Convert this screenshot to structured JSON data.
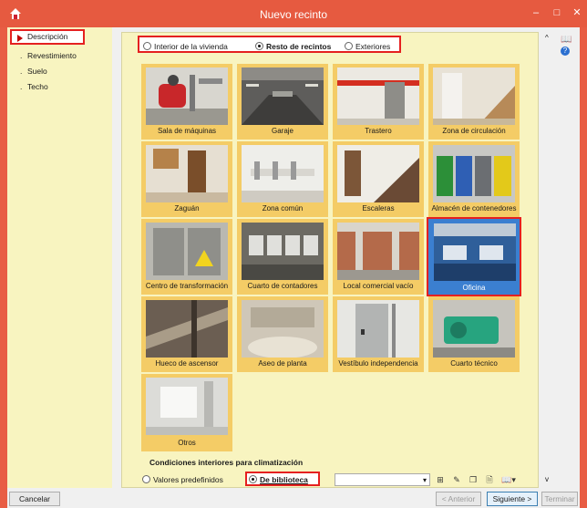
{
  "window": {
    "title": "Nuevo recinto",
    "minimize_glyph": "–",
    "maximize_glyph": "□",
    "close_glyph": "✕"
  },
  "sidebar": {
    "items": [
      {
        "label": "Descripción",
        "selected": true
      },
      {
        "label": "Revestimiento",
        "selected": false
      },
      {
        "label": "Suelo",
        "selected": false
      },
      {
        "label": "Techo",
        "selected": false
      }
    ],
    "bullet": "."
  },
  "scope": {
    "options": [
      {
        "label": "Interior de la vivienda",
        "selected": false
      },
      {
        "label": "Resto de recintos",
        "selected": true
      },
      {
        "label": "Exteriores",
        "selected": false
      }
    ]
  },
  "tiles": [
    {
      "label": "Sala de máquinas",
      "selected": false
    },
    {
      "label": "Garaje",
      "selected": false
    },
    {
      "label": "Trastero",
      "selected": false
    },
    {
      "label": "Zona de circulación",
      "selected": false
    },
    {
      "label": "Zaguán",
      "selected": false
    },
    {
      "label": "Zona común",
      "selected": false
    },
    {
      "label": "Escaleras",
      "selected": false
    },
    {
      "label": "Almacén de contenedores",
      "selected": false
    },
    {
      "label": "Centro de transformación",
      "selected": false
    },
    {
      "label": "Cuarto de contadores",
      "selected": false
    },
    {
      "label": "Local comercial vacío",
      "selected": false
    },
    {
      "label": "Oficina",
      "selected": true
    },
    {
      "label": "Hueco de ascensor",
      "selected": false
    },
    {
      "label": "Aseo de planta",
      "selected": false
    },
    {
      "label": "Vestíbulo independencia",
      "selected": false
    },
    {
      "label": "Cuarto técnico",
      "selected": false
    },
    {
      "label": "Otros",
      "selected": false
    }
  ],
  "climate": {
    "title": "Condiciones interiores para climatización",
    "option_default": "Valores predefinidos",
    "option_library": "De biblioteca",
    "selected": "library",
    "combo_value": ""
  },
  "footer": {
    "cancel": "Cancelar",
    "previous": "< Anterior",
    "next": "Siguiente >",
    "finish": "Terminar"
  },
  "colors": {
    "titlebar": "#e65a40",
    "panel": "#f8f4c0",
    "tile": "#f4cc66",
    "selected_tile": "#3b7fd0",
    "highlight": "#e52020"
  }
}
